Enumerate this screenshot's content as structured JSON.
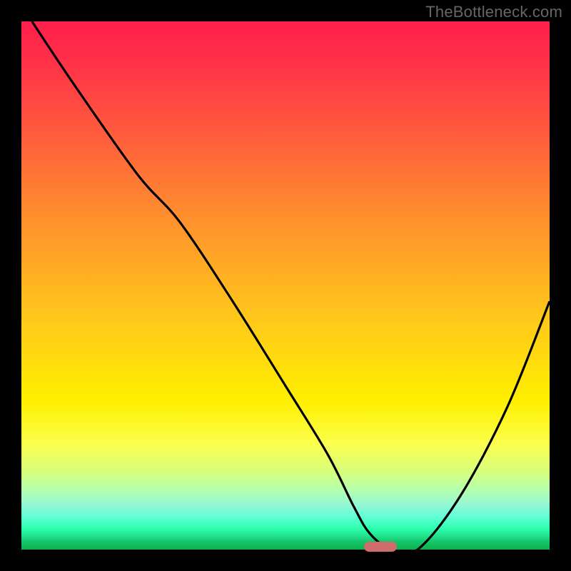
{
  "watermark": "TheBottleneck.com",
  "chart_data": {
    "type": "line",
    "title": "",
    "xlabel": "",
    "ylabel": "",
    "xlim": [
      0,
      100
    ],
    "ylim": [
      0,
      100
    ],
    "series": [
      {
        "name": "curve",
        "x": [
          2,
          10,
          22,
          30,
          40,
          50,
          58,
          63,
          66,
          70,
          75,
          83,
          92,
          100
        ],
        "values": [
          100,
          88,
          71,
          62,
          47,
          31,
          18,
          8,
          3,
          0,
          0,
          10,
          27,
          47
        ]
      }
    ],
    "marker": {
      "x": 68,
      "y": 0.5
    },
    "gradient_stops": [
      {
        "pct": 0,
        "color": "#ff1f4c"
      },
      {
        "pct": 22,
        "color": "#ff5e3c"
      },
      {
        "pct": 55,
        "color": "#ffc41c"
      },
      {
        "pct": 80,
        "color": "#fcff4e"
      },
      {
        "pct": 94,
        "color": "#5bffd4"
      },
      {
        "pct": 100,
        "color": "#0db24d"
      }
    ]
  }
}
